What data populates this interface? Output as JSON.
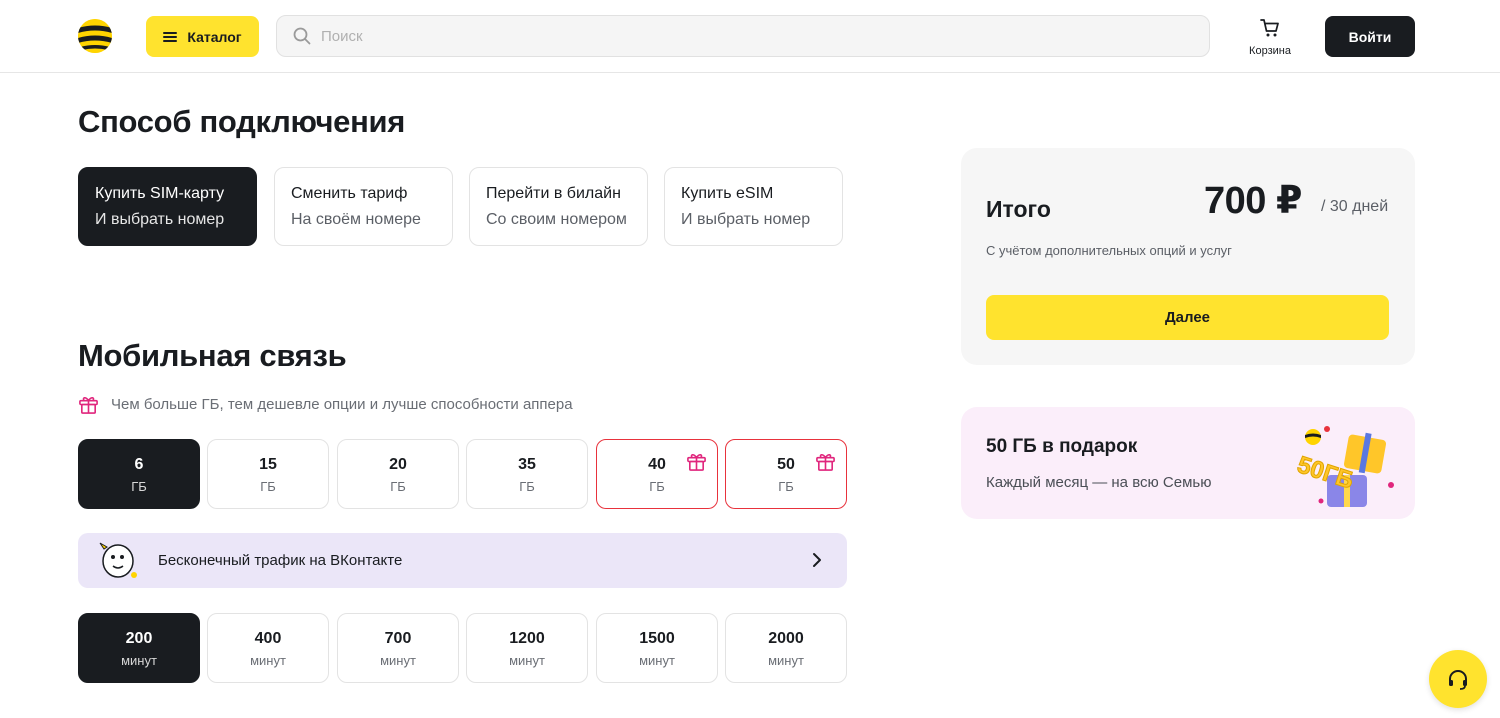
{
  "header": {
    "catalog_label": "Каталог",
    "search_placeholder": "Поиск",
    "cart_label": "Корзина",
    "login_label": "Войти"
  },
  "connection": {
    "title": "Способ подключения",
    "options": [
      {
        "title": "Купить SIM-карту",
        "subtitle": "И выбрать номер",
        "selected": true
      },
      {
        "title": "Сменить тариф",
        "subtitle": "На своём номере",
        "selected": false
      },
      {
        "title": "Перейти в билайн",
        "subtitle": "Со своим номером",
        "selected": false
      },
      {
        "title": "Купить eSIM",
        "subtitle": "И выбрать номер",
        "selected": false
      }
    ]
  },
  "mobile": {
    "title": "Мобильная связь",
    "hint": "Чем больше ГБ, тем дешевле опции и лучше способности аппера",
    "gb_options": [
      {
        "value": "6",
        "unit": "ГБ",
        "selected": true,
        "gift": false
      },
      {
        "value": "15",
        "unit": "ГБ",
        "selected": false,
        "gift": false
      },
      {
        "value": "20",
        "unit": "ГБ",
        "selected": false,
        "gift": false
      },
      {
        "value": "35",
        "unit": "ГБ",
        "selected": false,
        "gift": false
      },
      {
        "value": "40",
        "unit": "ГБ",
        "selected": false,
        "gift": true
      },
      {
        "value": "50",
        "unit": "ГБ",
        "selected": false,
        "gift": true
      }
    ],
    "vk_banner": "Бесконечный трафик на ВКонтакте",
    "minute_options": [
      {
        "value": "200",
        "unit": "минут",
        "selected": true
      },
      {
        "value": "400",
        "unit": "минут",
        "selected": false
      },
      {
        "value": "700",
        "unit": "минут",
        "selected": false
      },
      {
        "value": "1200",
        "unit": "минут",
        "selected": false
      },
      {
        "value": "1500",
        "unit": "минут",
        "selected": false
      },
      {
        "value": "2000",
        "unit": "минут",
        "selected": false
      }
    ]
  },
  "summary": {
    "title": "Итого",
    "price": "700 ₽",
    "period": "/ 30 дней",
    "note": "С учётом дополнительных опций и услуг",
    "next_label": "Далее"
  },
  "promo": {
    "title": "50 ГБ в подарок",
    "subtitle": "Каждый месяц — на всю Семью",
    "art_text": "50ГБ"
  },
  "colors": {
    "accent_yellow": "#ffe32e",
    "dark": "#191c20",
    "gift_red": "#e8323c",
    "gift_pink": "#e0267d"
  },
  "icons": {
    "logo": "beeline-logo",
    "menu": "burger-icon",
    "search": "search-icon",
    "cart": "cart-icon",
    "gift": "gift-icon",
    "chevron": "chevron-right-icon",
    "support": "headset-icon"
  }
}
